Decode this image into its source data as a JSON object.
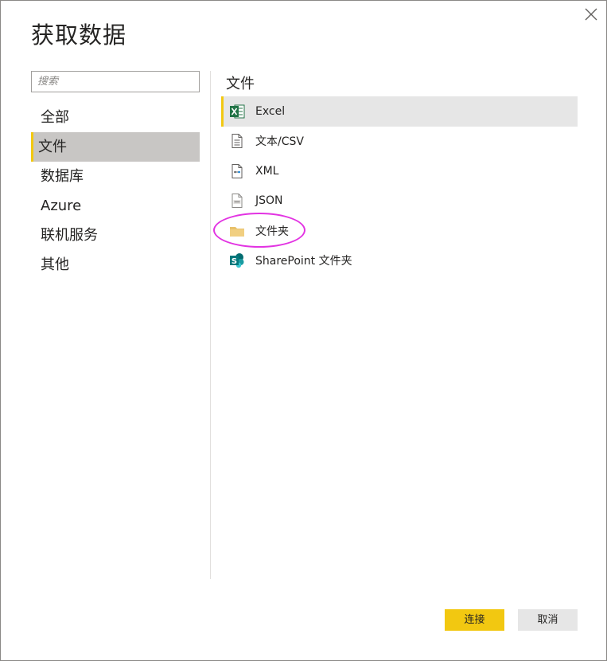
{
  "dialog": {
    "title": "获取数据",
    "close_icon": "close-icon"
  },
  "search": {
    "placeholder": "搜索",
    "value": ""
  },
  "categories": [
    {
      "label": "全部",
      "selected": false
    },
    {
      "label": "文件",
      "selected": true
    },
    {
      "label": "数据库",
      "selected": false
    },
    {
      "label": "Azure",
      "selected": false
    },
    {
      "label": "联机服务",
      "selected": false
    },
    {
      "label": "其他",
      "selected": false
    }
  ],
  "section": {
    "title": "文件"
  },
  "items": [
    {
      "label": "Excel",
      "icon": "excel-icon",
      "selected": true
    },
    {
      "label": "文本/CSV",
      "icon": "text-file-icon",
      "selected": false
    },
    {
      "label": "XML",
      "icon": "xml-icon",
      "selected": false
    },
    {
      "label": "JSON",
      "icon": "json-icon",
      "selected": false
    },
    {
      "label": "文件夹",
      "icon": "folder-icon",
      "selected": false,
      "highlighted": true
    },
    {
      "label": "SharePoint 文件夹",
      "icon": "sharepoint-icon",
      "selected": false
    }
  ],
  "colors": {
    "accent": "#f2c811",
    "highlight_ring": "#e233e2",
    "selected_category_bg": "#c8c6c4",
    "selected_item_bg": "#e6e6e6"
  },
  "buttons": {
    "connect": "连接",
    "cancel": "取消"
  }
}
